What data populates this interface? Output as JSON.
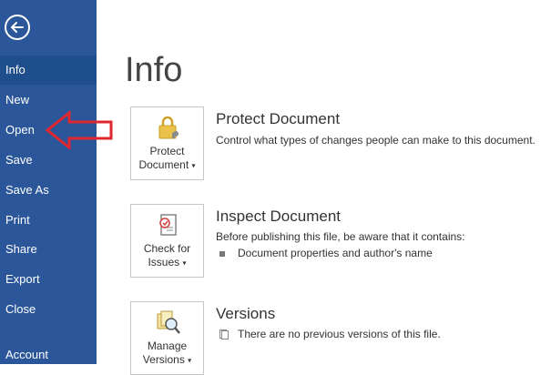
{
  "sidebar": {
    "items": [
      {
        "label": "Info"
      },
      {
        "label": "New"
      },
      {
        "label": "Open"
      },
      {
        "label": "Save"
      },
      {
        "label": "Save As"
      },
      {
        "label": "Print"
      },
      {
        "label": "Share"
      },
      {
        "label": "Export"
      },
      {
        "label": "Close"
      },
      {
        "label": "Account"
      }
    ],
    "active": "Info"
  },
  "main": {
    "title": "Info",
    "protect": {
      "tile_line1": "Protect",
      "tile_line2": "Document",
      "heading": "Protect Document",
      "description": "Control what types of changes people can make to this document."
    },
    "inspect": {
      "tile_line1": "Check for",
      "tile_line2": "Issues",
      "heading": "Inspect Document",
      "description": "Before publishing this file, be aware that it contains:",
      "bullet": "Document properties and author's name"
    },
    "versions": {
      "tile_line1": "Manage",
      "tile_line2": "Versions",
      "heading": "Versions",
      "note": "There are no previous versions of this file."
    }
  },
  "colors": {
    "sidebar": "#2b579a",
    "active_item": "#1e4e8c",
    "annotation_arrow": "#e0262f"
  }
}
